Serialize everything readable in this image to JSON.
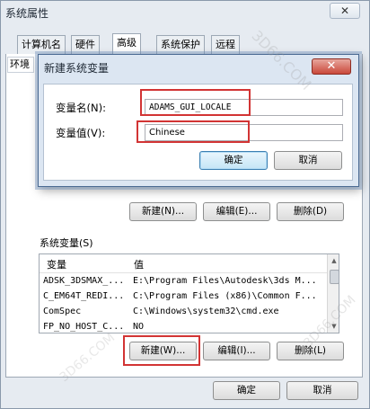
{
  "window": {
    "title": "系统属性",
    "close_glyph": "✕",
    "tabs": [
      "计算机名",
      "硬件",
      "高级",
      "系统保护",
      "远程"
    ],
    "selected_tab": "高级"
  },
  "env_tab_label": "环境",
  "user_vars_buttons": {
    "new": "新建(N)...",
    "edit": "编辑(E)...",
    "delete": "删除(D)"
  },
  "system_vars": {
    "label": "系统变量(S)",
    "columns": [
      "变量",
      "值"
    ],
    "rows": [
      {
        "name": "ADSK_3DSMAX_...",
        "value": "E:\\Program Files\\Autodesk\\3ds M..."
      },
      {
        "name": "C_EM64T_REDI...",
        "value": "C:\\Program Files (x86)\\Common F..."
      },
      {
        "name": "ComSpec",
        "value": "C:\\Windows\\system32\\cmd.exe"
      },
      {
        "name": "FP_NO_HOST_C...",
        "value": "NO"
      }
    ],
    "buttons": {
      "new": "新建(W)...",
      "edit": "编辑(I)...",
      "delete": "删除(L)"
    }
  },
  "footer": {
    "ok": "确定",
    "cancel": "取消"
  },
  "dialog": {
    "title": "新建系统变量",
    "close_glyph": "✕",
    "name_label": "变量名(N):",
    "name_value": "ADAMS_GUI_LOCALE",
    "value_label": "变量值(V):",
    "value_value": "Chinese",
    "ok": "确定",
    "cancel": "取消"
  },
  "watermark": "3D66.COM",
  "colors": {
    "highlight": "#d23434",
    "dialog_border": "#4a6a92",
    "close_red": "#c9483a"
  }
}
